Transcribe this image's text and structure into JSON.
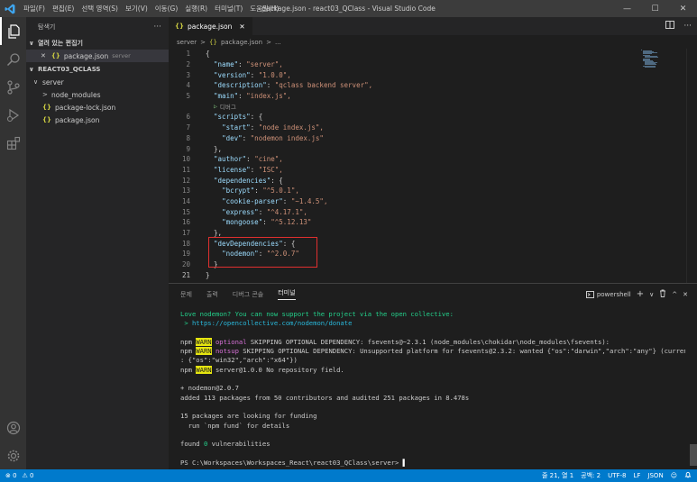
{
  "titlebar": {
    "menu": [
      "파일(F)",
      "편집(E)",
      "선택 영역(S)",
      "보기(V)",
      "이동(G)",
      "실행(R)",
      "터미널(T)",
      "도움말(H)"
    ],
    "title": "package.json - react03_QClass - Visual Studio Code",
    "minimize": "—",
    "maximize": "☐",
    "close": "✕"
  },
  "sidebar": {
    "header": "탐색기",
    "more": "···",
    "open_editors_title": "열려 있는 편집기",
    "open_editor": {
      "close": "✕",
      "icon": "{}",
      "name": "package.json",
      "folder": "server"
    },
    "project_title": "REACT03_QCLASS",
    "tree": [
      {
        "type": "folder-open",
        "label": "server",
        "indent": 0
      },
      {
        "type": "folder",
        "label": "node_modules",
        "indent": 1
      },
      {
        "type": "json",
        "label": "package-lock.json",
        "indent": 1
      },
      {
        "type": "json",
        "label": "package.json",
        "indent": 1
      }
    ]
  },
  "editor": {
    "tab": {
      "icon": "{}",
      "label": "package.json",
      "close": "✕"
    },
    "breadcrumb": [
      "server",
      ">",
      "{}",
      "package.json",
      ">",
      "..."
    ],
    "codelens": "디버그",
    "lines_before_lens": [
      {
        "n": "1",
        "code": "{"
      },
      {
        "n": "2",
        "key": "\"name\"",
        "val": "\"server\","
      },
      {
        "n": "3",
        "key": "\"version\"",
        "val": "\"1.0.0\","
      },
      {
        "n": "4",
        "key": "\"description\"",
        "val": "\"qclass backend server\","
      },
      {
        "n": "5",
        "key": "\"main\"",
        "val": "\"index.js\","
      }
    ],
    "lines_after_lens": [
      {
        "n": "6",
        "key": "\"scripts\"",
        "val": "{",
        "val_plain": true
      },
      {
        "n": "7",
        "indent": 2,
        "key": "\"start\"",
        "val": "\"node index.js\","
      },
      {
        "n": "8",
        "indent": 2,
        "key": "\"dev\"",
        "val": "\"nodemon index.js\""
      },
      {
        "n": "9",
        "code": "},"
      },
      {
        "n": "10",
        "key": "\"author\"",
        "val": "\"cine\","
      },
      {
        "n": "11",
        "key": "\"license\"",
        "val": "\"ISC\","
      },
      {
        "n": "12",
        "key": "\"dependencies\"",
        "val": "{",
        "val_plain": true
      },
      {
        "n": "13",
        "indent": 2,
        "key": "\"bcrypt\"",
        "val": "\"^5.0.1\","
      },
      {
        "n": "14",
        "indent": 2,
        "key": "\"cookie-parser\"",
        "val": "\"~1.4.5\","
      },
      {
        "n": "15",
        "indent": 2,
        "key": "\"express\"",
        "val": "\"^4.17.1\","
      },
      {
        "n": "16",
        "indent": 2,
        "key": "\"mongoose\"",
        "val": "\"^5.12.13\""
      },
      {
        "n": "17",
        "code": "},"
      },
      {
        "n": "18",
        "key": "\"devDependencies\"",
        "val": "{",
        "val_plain": true
      },
      {
        "n": "19",
        "indent": 2,
        "key": "\"nodemon\"",
        "val": "\"^2.0.7\""
      },
      {
        "n": "20",
        "code": "}"
      },
      {
        "n": "21",
        "code": "}",
        "root": true
      }
    ]
  },
  "panel": {
    "tabs": [
      "문제",
      "출력",
      "디버그 콘솔",
      "터미널"
    ],
    "active_tab": "터미널",
    "shell": "powershell",
    "add": "+",
    "chevron": "∨",
    "trash": "🗑",
    "maximize": "^",
    "close": "✕",
    "terminal": {
      "l1": "Love nodemon? You can now support the project via the open collective:",
      "l2_prefix": " > ",
      "l2_link": "https://opencollective.com/nodemon/donate",
      "npm": "npm",
      "warn": "WARN",
      "l3_tag": "optional",
      "l3_rest": " SKIPPING OPTIONAL DEPENDENCY: fsevents@~2.3.1 (node_modules\\chokidar\\node_modules\\fsevents):",
      "l4_tag": "notsup",
      "l4_rest": " SKIPPING OPTIONAL DEPENDENCY: Unsupported platform for fsevents@2.3.2: wanted {\"os\":\"darwin\",\"arch\":\"any\"} (current",
      "l5": ": {\"os\":\"win32\",\"arch\":\"x64\"})",
      "l6_rest": " server@1.0.0 No repository field.",
      "l7": "+ nodemon@2.0.7",
      "l8": "added 113 packages from 50 contributors and audited 251 packages in 8.478s",
      "l9": "15 packages are looking for funding",
      "l10": "  run `npm fund` for details",
      "l11_prefix": "found ",
      "l11_zero": "0",
      "l11_rest": " vulnerabilities",
      "l12": "PS C:\\Workspaces\\Workspaces_React\\react03_QClass\\server> ",
      "cursor": "▌"
    }
  },
  "statusbar": {
    "errors": "⊗ 0",
    "warnings": "⚠ 0",
    "position": "줄 21, 열 1",
    "spaces": "공백: 2",
    "encoding": "UTF-8",
    "eol": "LF",
    "language": "JSON",
    "feedback": "☺",
    "bell": "🔔"
  },
  "colors": {
    "accent": "#007acc",
    "highlight_border": "#e0302f",
    "warn_bg": "#e5e510"
  }
}
